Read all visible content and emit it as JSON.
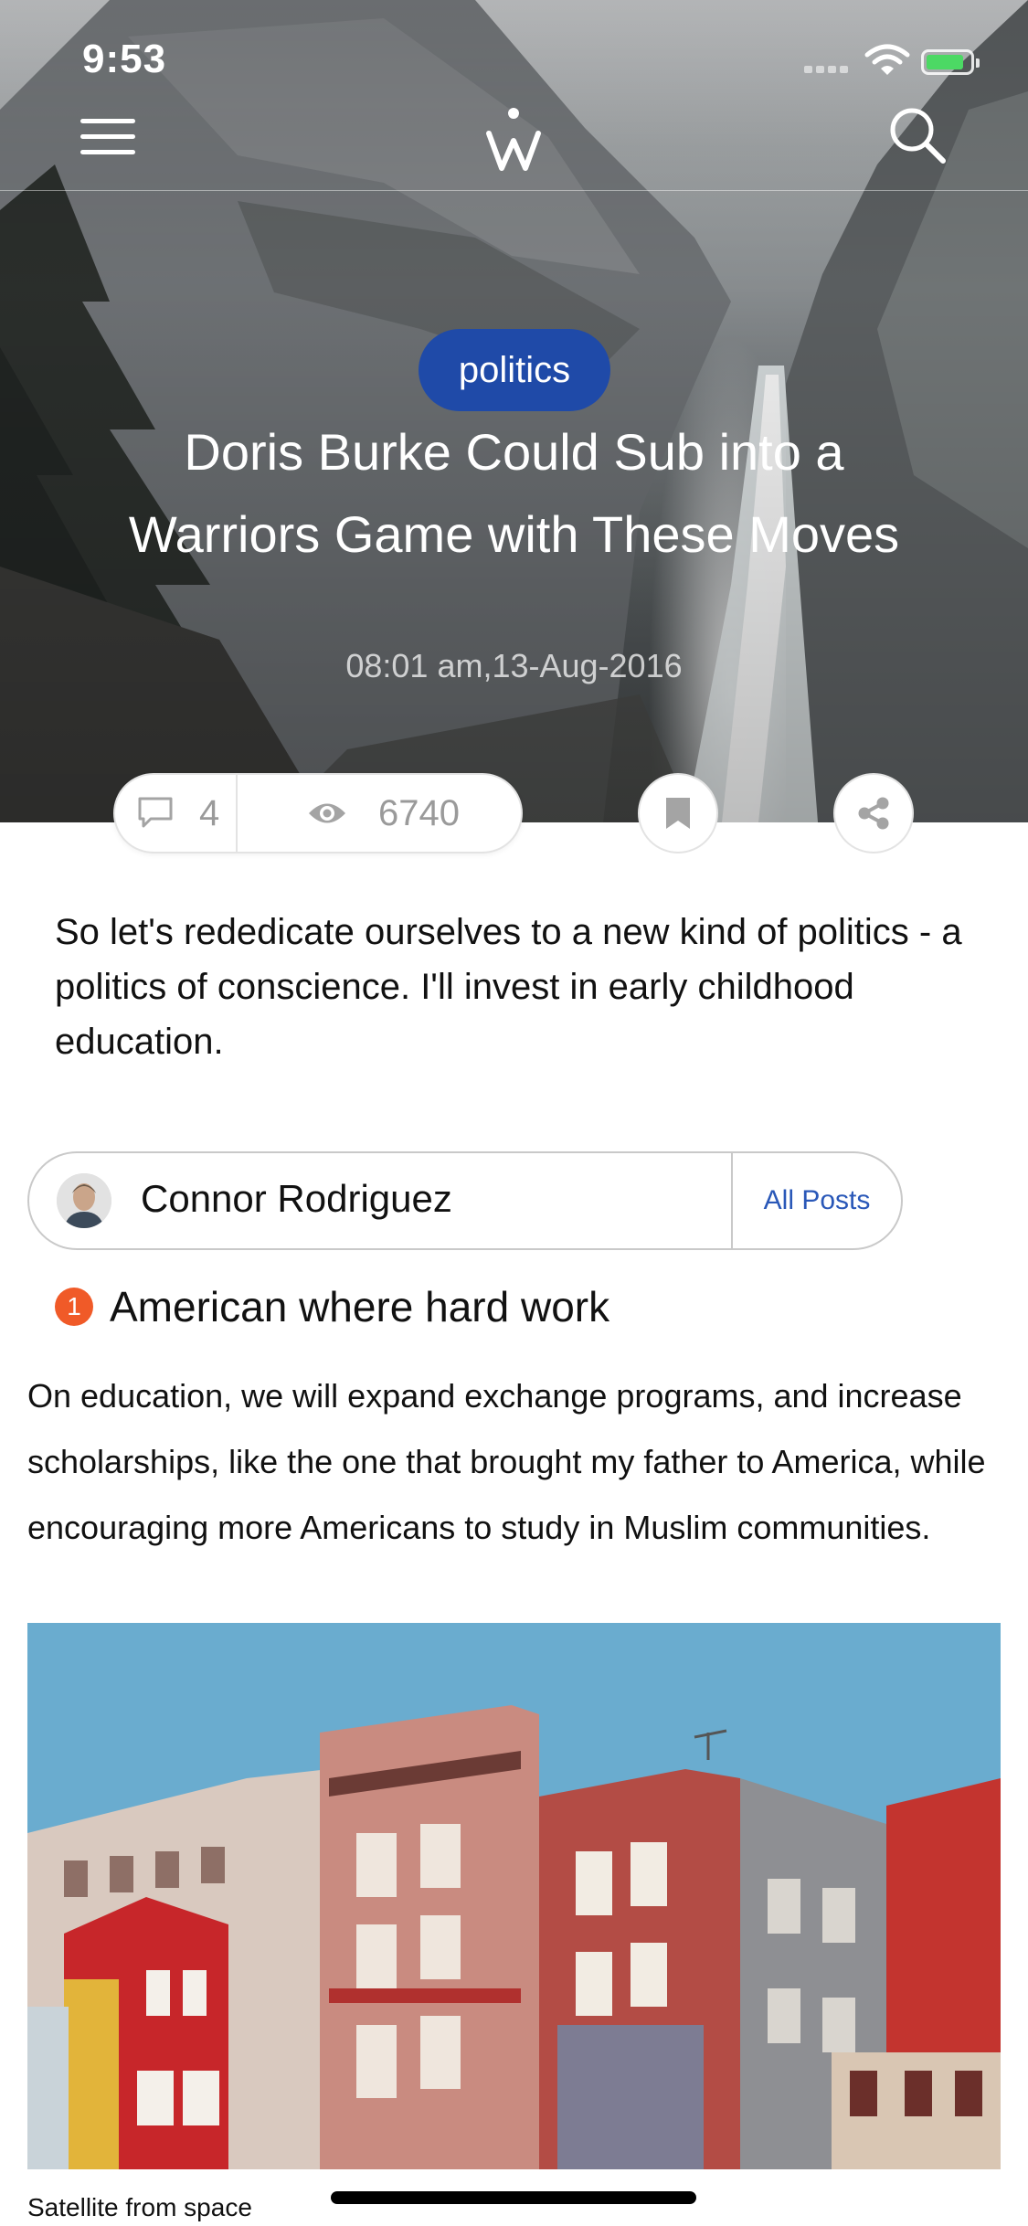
{
  "status_bar": {
    "time": "9:53"
  },
  "article": {
    "category": "politics",
    "title": "Doris Burke Could Sub into a Warriors Game with These Moves",
    "date": "08:01 am,13-Aug-2016",
    "comments_count": "4",
    "views_count": "6740",
    "lead": "So let's rededicate ourselves to a new kind of politics - a politics of conscience. I'll invest in early childhood education."
  },
  "author": {
    "name": "Connor Rodriguez",
    "all_posts_label": "All Posts"
  },
  "section": {
    "number": "1",
    "title": "American where hard work",
    "paragraph": "On education, we will expand exchange programs, and increase scholarships, like the one that brought my father to America, while encouraging more Americans to study in Muslim communities."
  },
  "photo": {
    "caption": "Satellite from space"
  },
  "icons": {
    "menu": "hamburger-menu-icon",
    "logo": "w-logo-icon",
    "search": "search-icon",
    "comments": "comment-bubble-icon",
    "views": "eye-icon",
    "bookmark": "bookmark-icon",
    "share": "share-icon",
    "wifi": "wifi-icon",
    "battery": "battery-charging-icon"
  },
  "colors": {
    "category_pill": "#1f4aa8",
    "all_posts_link": "#2a58b8",
    "number_badge": "#f05a28",
    "battery_fill": "#4cd964"
  }
}
